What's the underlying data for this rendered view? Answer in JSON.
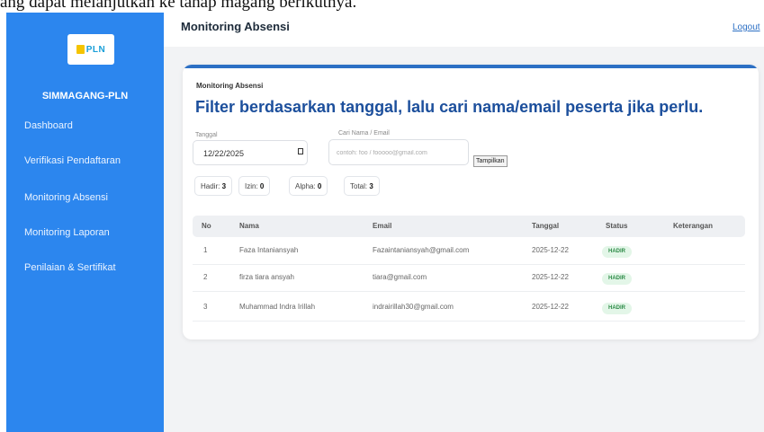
{
  "overlay_text": "ang dapat melanjutkan ke tahap magang berikutnya.",
  "sidebar": {
    "logo_text": "PLN",
    "brand": "SIMMAGANG-PLN",
    "items": [
      {
        "label": "Dashboard"
      },
      {
        "label": "Verifikasi Pendaftaran"
      },
      {
        "label": "Monitoring Absensi"
      },
      {
        "label": "Monitoring Laporan"
      },
      {
        "label": "Penilaian & Sertifikat"
      }
    ]
  },
  "header": {
    "title": "Monitoring Absensi",
    "logout": "Logout"
  },
  "card": {
    "breadcrumb": "Monitoring Absensi",
    "headline": "Filter berdasarkan tanggal, lalu cari nama/email peserta jika perlu.",
    "date_label": "Tanggal",
    "date_value": "12/22/2025",
    "search_label": "Cari Nama / Email",
    "search_placeholder": "contoh: foo / fooooo@gmail.com",
    "show_button": "Tampilkan",
    "summary": [
      {
        "label": "Hadir:",
        "value": "3"
      },
      {
        "label": "Izin:",
        "value": "0"
      },
      {
        "label": "Alpha:",
        "value": "0"
      },
      {
        "label": "Total:",
        "value": "3"
      }
    ],
    "table": {
      "headers": [
        "No",
        "Nama",
        "Email",
        "Tanggal",
        "Status",
        "Keterangan"
      ],
      "rows": [
        {
          "no": "1",
          "nama": "Faza Intaniansyah",
          "email": "Fazaintaniansyah@gmail.com",
          "tanggal": "2025-12-22",
          "status": "HADIR",
          "keterangan": ""
        },
        {
          "no": "2",
          "nama": "firza tiara ansyah",
          "email": "tiara@gmail.com",
          "tanggal": "2025-12-22",
          "status": "HADIR",
          "keterangan": ""
        },
        {
          "no": "3",
          "nama": "Muhammad Indra Irillah",
          "email": "indrairillah30@gmail.com",
          "tanggal": "2025-12-22",
          "status": "HADIR",
          "keterangan": ""
        }
      ]
    }
  },
  "colors": {
    "sidebar": "#2c86ee",
    "accent": "#2c6fc4",
    "headline": "#1c4f9c",
    "badge_bg": "#e3f6e8",
    "badge_text": "#2e8b48"
  }
}
